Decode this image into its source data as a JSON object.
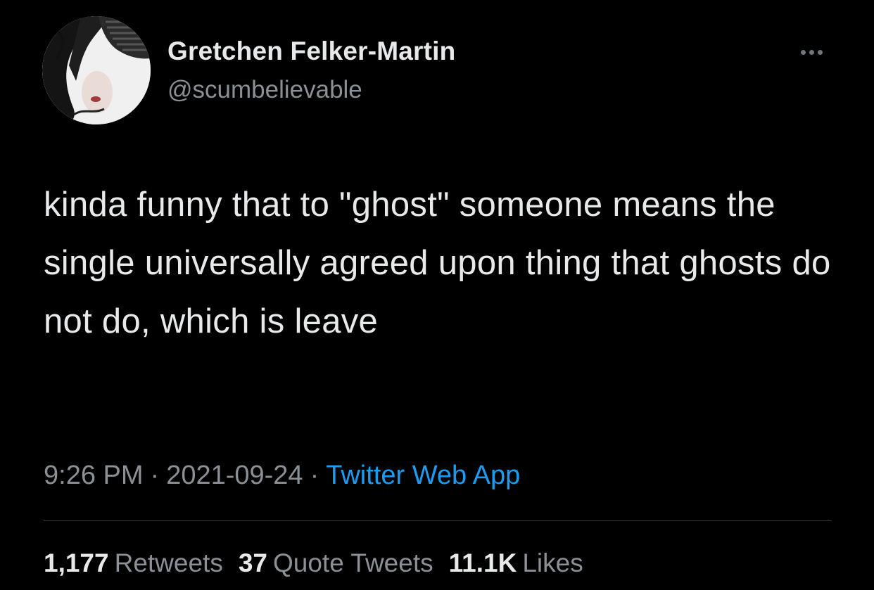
{
  "author": {
    "name": "Gretchen Felker-Martin",
    "handle": "@scumbelievable",
    "avatar_icon": "profile-photo"
  },
  "more_icon": "more-horizontal-icon",
  "tweet": {
    "text": "kinda funny that to \"ghost\" someone means the single universally agreed upon thing that ghosts do not do, which is leave"
  },
  "meta": {
    "time": "9:26 PM",
    "separator": "·",
    "date": "2021-09-24",
    "source": "Twitter Web App"
  },
  "stats": {
    "retweets": {
      "count": "1,177",
      "label": "Retweets"
    },
    "quote_tweets": {
      "count": "37",
      "label": "Quote Tweets"
    },
    "likes": {
      "count": "11.1K",
      "label": "Likes"
    }
  },
  "colors": {
    "background": "#000000",
    "text_primary": "#e7e9ea",
    "text_secondary": "#8b9096",
    "link": "#1d9bf0",
    "divider": "#2f3336"
  }
}
